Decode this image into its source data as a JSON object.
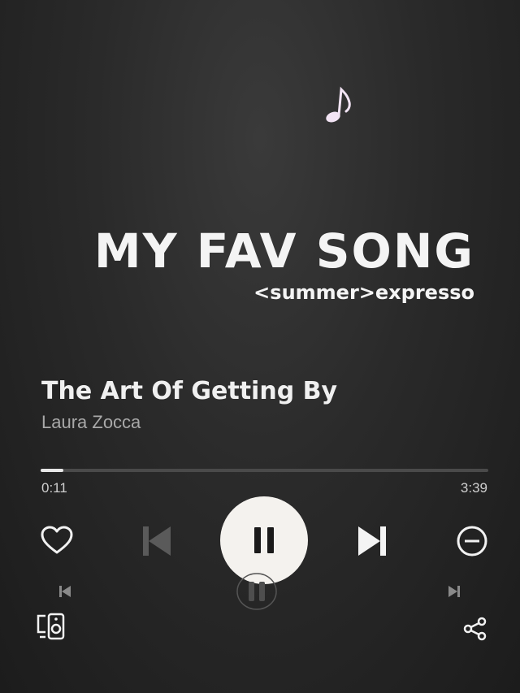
{
  "header": {
    "headline": "MY FAV SONG",
    "subheadline": "<summer>expresso"
  },
  "track": {
    "title": "The Art Of Getting By",
    "artist": "Laura Zocca"
  },
  "playback": {
    "elapsed": "0:11",
    "duration": "3:39",
    "progress_fraction": 0.05,
    "state": "playing"
  },
  "controls": {
    "like_icon": "heart-outline-icon",
    "previous_icon": "skip-previous-icon",
    "pause_icon": "pause-icon",
    "next_icon": "skip-next-icon",
    "remove_icon": "minus-circle-icon",
    "devices_icon": "connect-devices-icon",
    "share_icon": "share-icon"
  },
  "colors": {
    "background": "#2a2a2a",
    "text_primary": "#f4f4f4",
    "text_secondary": "#a8a8a8",
    "play_button": "#f4f2ee",
    "note_accent": "#e8d8ec"
  }
}
